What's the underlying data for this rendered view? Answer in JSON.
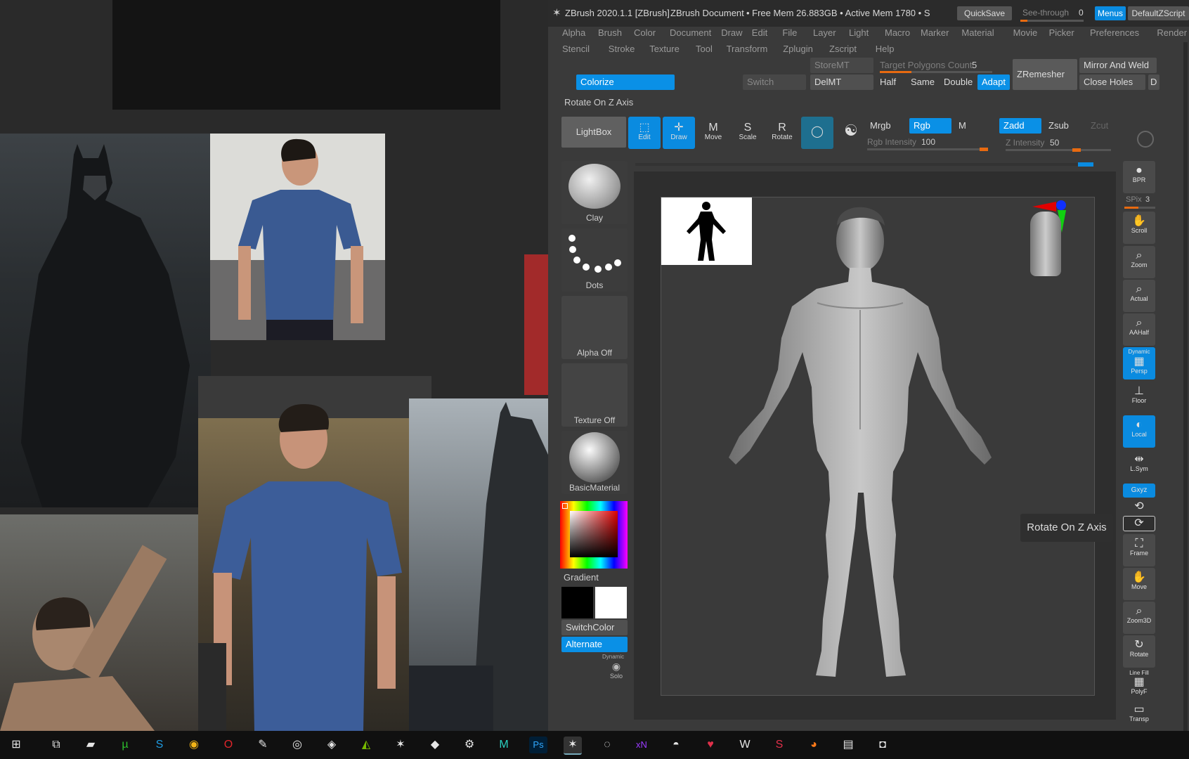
{
  "app": {
    "title": "ZBrush 2020.1.1 [ZBrush]",
    "doc_title": "ZBrush Document",
    "mem": "• Free Mem 26.883GB • Active Mem 1780 • S",
    "quicksave": "QuickSave",
    "see_through": "See-through",
    "see_through_value": "0",
    "menus_btn": "Menus",
    "default_script": "DefaultZScript"
  },
  "menu_row1": [
    "Alpha",
    "Brush",
    "Color",
    "Document",
    "Draw",
    "Edit",
    "File",
    "Layer",
    "Light",
    "Macro",
    "Marker",
    "Material",
    "Movie",
    "Picker",
    "Preferences",
    "Render"
  ],
  "menu_row2": [
    "Stencil",
    "Stroke",
    "Texture",
    "Tool",
    "Transform",
    "Zplugin",
    "Zscript",
    "Help"
  ],
  "shelf": {
    "colorize": "Colorize",
    "switch": "Switch",
    "store_mt": "StoreMT",
    "del_mt": "DelMT",
    "target_poly_label": "Target Polygons Count",
    "target_poly_value": "5",
    "half": "Half",
    "same": "Same",
    "double": "Double",
    "adapt": "Adapt",
    "zremesher": "ZRemesher",
    "mirror_weld": "Mirror And Weld",
    "close_holes": "Close Holes",
    "d": "D"
  },
  "status_text": "Rotate On Z Axis",
  "toolbar": {
    "lightbox": "LightBox",
    "edit": "Edit",
    "draw": "Draw",
    "move": "Move",
    "scale": "Scale",
    "rotate": "Rotate",
    "mrgb": "Mrgb",
    "rgb": "Rgb",
    "m": "M",
    "rgb_intensity_label": "Rgb Intensity",
    "rgb_intensity_value": "100",
    "zadd": "Zadd",
    "zsub": "Zsub",
    "zcut": "Zcut",
    "z_intensity_label": "Z Intensity",
    "z_intensity_value": "50"
  },
  "left_tray": {
    "brush": "Clay",
    "stroke": "Dots",
    "alpha": "Alpha Off",
    "texture": "Texture Off",
    "material": "BasicMaterial",
    "gradient": "Gradient",
    "switchcolor": "SwitchColor",
    "alternate": "Alternate",
    "dynamic": "Dynamic",
    "solo": "Solo"
  },
  "right_tray": {
    "bpr": "BPR",
    "spix_label": "SPix",
    "spix_value": "3",
    "scroll": "Scroll",
    "zoom": "Zoom",
    "actual": "Actual",
    "aahalf": "AAHalf",
    "dynamic": "Dynamic",
    "persp": "Persp",
    "floor": "Floor",
    "local": "Local",
    "lsym": "L.Sym",
    "xyz": "Gxyz",
    "frame": "Frame",
    "move": "Move",
    "zoom3d": "Zoom3D",
    "rotate": "Rotate",
    "line_fill": "Line Fill",
    "polyf": "PolyF",
    "transp": "Transp"
  },
  "tooltip": "Rotate On Z Axis",
  "colors": {
    "accent_blue": "#0a8be0",
    "orange": "#e86a10",
    "panel": "#3a3a3a"
  },
  "taskbar_icons": [
    "windows-icon",
    "task-view-icon",
    "file-explorer-icon",
    "utorrent-icon",
    "skype-icon",
    "chrome-icon",
    "opera-icon",
    "notepad-icon",
    "obs-icon",
    "discord-icon",
    "nvidia-icon",
    "zbrush-icon",
    "substance-icon",
    "steam-icon",
    "marvelous-icon",
    "photoshop-icon",
    "zbrush-active-icon",
    "app-icon",
    "xnview-icon",
    "app2-icon",
    "app3-icon",
    "w3-icon",
    "app4-icon",
    "firefox-icon",
    "mpc-icon",
    "app5-icon"
  ],
  "taskbar_labels": {
    "photoshop": "Ps",
    "xnview": "xN"
  }
}
